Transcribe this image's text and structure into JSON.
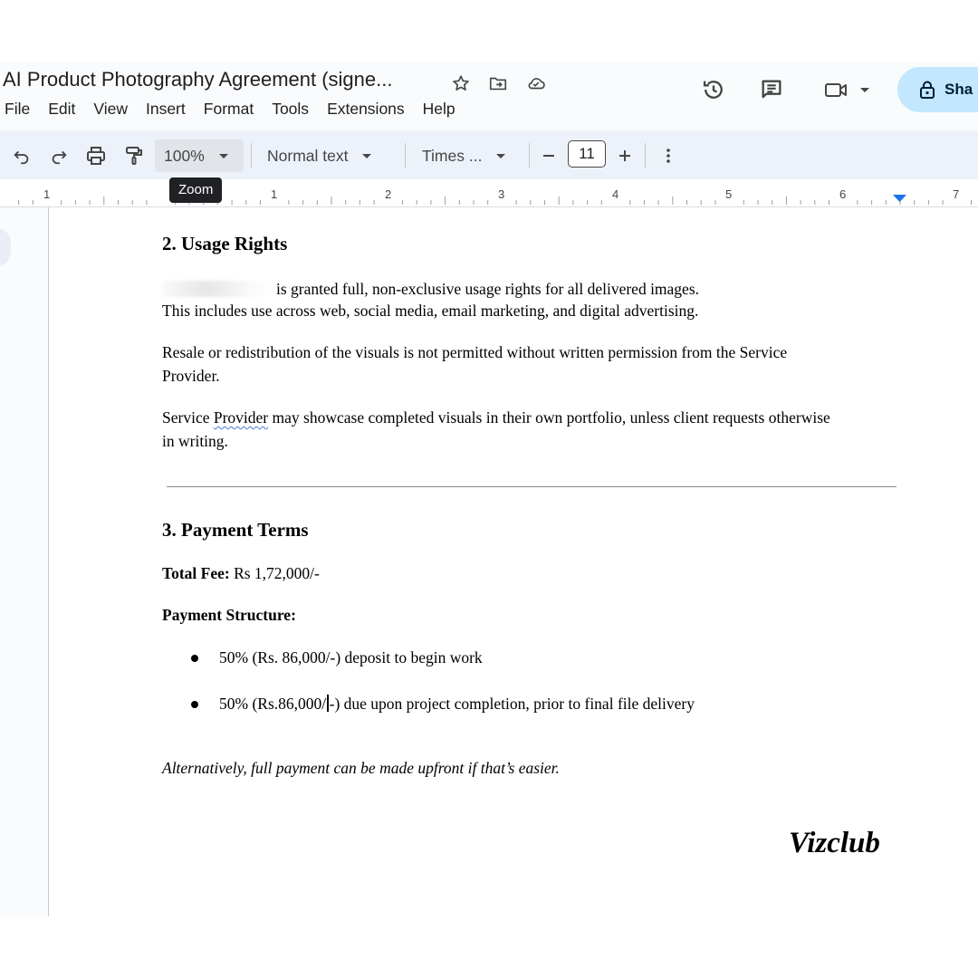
{
  "header": {
    "title": "AI Product Photography Agreement (signe...",
    "menu": [
      "File",
      "Edit",
      "View",
      "Insert",
      "Format",
      "Tools",
      "Extensions",
      "Help"
    ],
    "share_label": "Sha"
  },
  "toolbar": {
    "zoom": "100%",
    "style": "Normal text",
    "font": "Times ...",
    "font_size": "11",
    "tooltip": "Zoom"
  },
  "ruler": {
    "labels": [
      "1",
      "1",
      "2",
      "3",
      "4",
      "5",
      "6",
      "7"
    ]
  },
  "document": {
    "usage_heading": "2. Usage Rights",
    "usage_p1_rest": "is granted full, non-exclusive usage rights for all delivered images.",
    "usage_p1_line2": "This includes use across web, social media, email marketing, and digital advertising.",
    "usage_p2_line1": "Resale or redistribution of the visuals is not permitted without written permission from the Service",
    "usage_p2_line2": "Provider.",
    "usage_p3_pre": "Service ",
    "usage_p3_flag": "Provider",
    "usage_p3_post": " may showcase completed visuals in their own portfolio, unless client requests otherwise",
    "usage_p3_line2": "in writing.",
    "payment_heading": "3. Payment Terms",
    "total_fee_label": "Total Fee:",
    "total_fee_value": " Rs 1,72,000/-",
    "structure_label": "Payment Structure:",
    "bullet1": "50% (Rs. 86,000/-) deposit to begin work",
    "bullet2_pre": "50% (Rs.86,000/",
    "bullet2_post": "-) due upon project completion, prior to final file delivery",
    "alt_note": "Alternatively, full payment can be made upfront if that’s easier.",
    "signature": "Vizclub"
  }
}
